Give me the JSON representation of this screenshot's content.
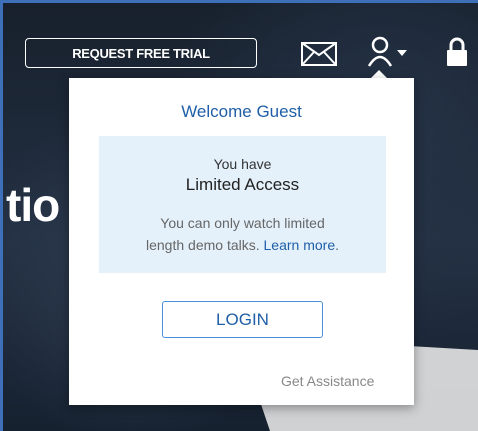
{
  "header": {
    "trial_button": "REQUEST FREE TRIAL"
  },
  "hero": {
    "partial_text": "tio"
  },
  "icons": {
    "mail": "envelope-icon",
    "user": "user-icon",
    "caret": "caret-down-icon",
    "lock": "lock-icon"
  },
  "dropdown": {
    "welcome": "Welcome Guest",
    "info_line1": "You have",
    "info_line2": "Limited Access",
    "info_desc_line1": "You can only watch limited",
    "info_desc_line2_prefix": "length demo talks.",
    "learn_more": "Learn more",
    "info_desc_suffix": ".",
    "login_button": "LOGIN",
    "get_assistance": "Get Assistance"
  },
  "colors": {
    "accent": "#1f5fa8",
    "info_bg": "#e4f1fb",
    "border": "#3d70b8"
  }
}
